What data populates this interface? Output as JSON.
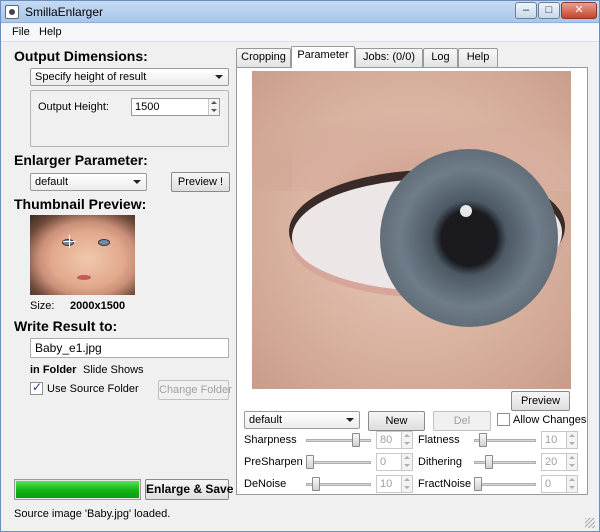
{
  "window": {
    "title": "SmillaEnlarger"
  },
  "menu": {
    "items": [
      "File",
      "Help"
    ]
  },
  "output_dimensions": {
    "heading": "Output Dimensions:",
    "mode": "Specify height of result",
    "height_label": "Output Height:",
    "height_value": "1500"
  },
  "enlarger_parameter": {
    "heading": "Enlarger Parameter:",
    "preset": "default",
    "preview_button": "Preview !"
  },
  "thumbnail": {
    "heading": "Thumbnail Preview:",
    "size_label": "Size:",
    "size_value": "2000x1500"
  },
  "write_result": {
    "heading": "Write Result to:",
    "filename": "Baby_e1.jpg",
    "folder_label": "in Folder",
    "folder_value": "Slide Shows",
    "use_source_label": "Use Source Folder",
    "use_source_checked": true,
    "change_folder_button": "Change Folder"
  },
  "actions": {
    "enlarge_save_button": "Enlarge & Save",
    "progress_percent": 100,
    "status_text": "Source image 'Baby.jpg' loaded."
  },
  "tabs": {
    "items": [
      "Cropping",
      "Parameter",
      "Jobs: (0/0)",
      "Log",
      "Help"
    ],
    "active": "Parameter"
  },
  "parameter_panel": {
    "preview_button": "Preview",
    "preset": "default",
    "new_button": "New",
    "del_button": "Del",
    "allow_changes_label": "Allow Changes",
    "allow_changes_checked": false,
    "sharpness": {
      "label": "Sharpness",
      "value": "80",
      "level": 80
    },
    "flatness": {
      "label": "Flatness",
      "value": "10",
      "level": 10
    },
    "presharpen": {
      "label": "PreSharpen",
      "value": "0",
      "level": 0
    },
    "dithering": {
      "label": "Dithering",
      "value": "20",
      "level": 20
    },
    "denoise": {
      "label": "DeNoise",
      "value": "10",
      "level": 10
    },
    "fractnoise": {
      "label": "FractNoise",
      "value": "0",
      "level": 0
    }
  },
  "icons": {
    "app": "app-icon",
    "minimize": "minimize-icon",
    "maximize": "maximize-icon",
    "close": "close-icon",
    "dropdown": "chevron-down-icon",
    "crosshair": "crosshair-icon"
  },
  "colors": {
    "progress_fill": "#13b413",
    "titlebar": "#a9c6ea"
  }
}
